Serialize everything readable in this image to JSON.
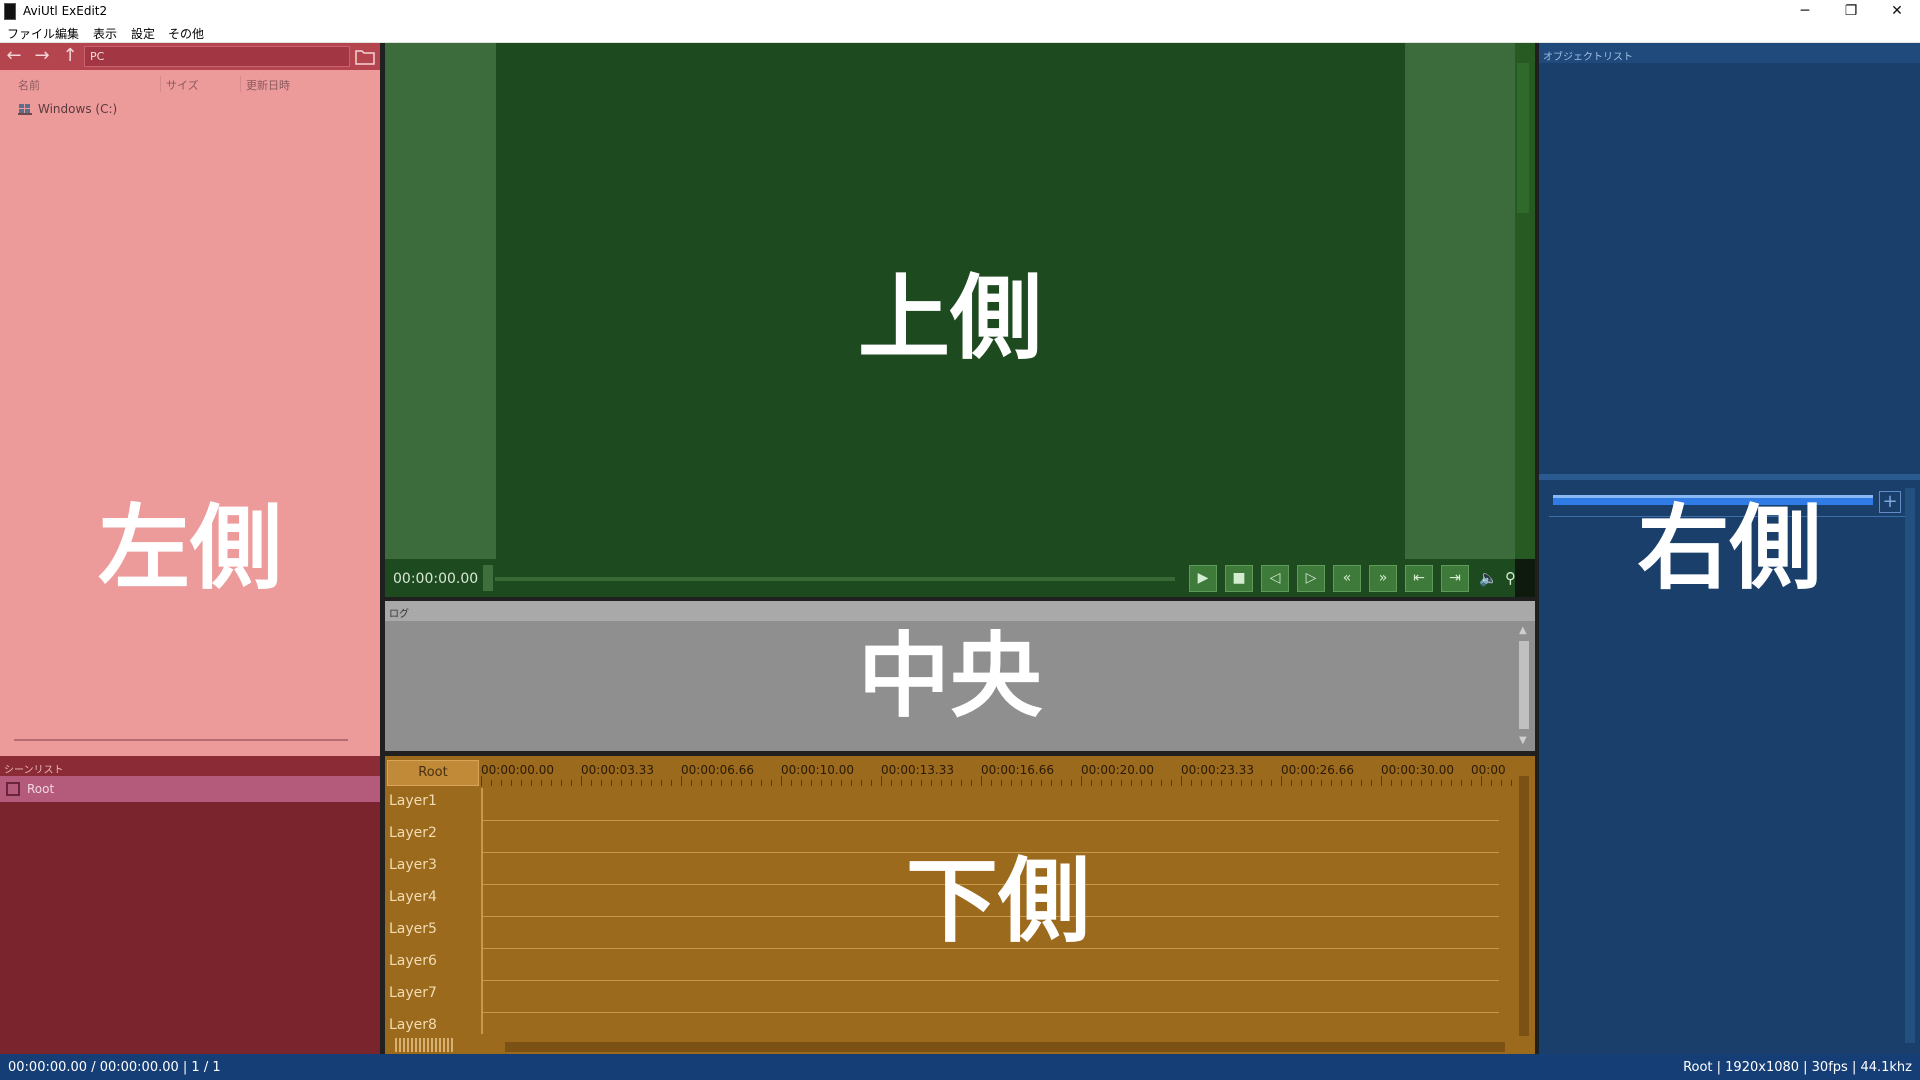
{
  "window": {
    "title": "AviUtl ExEdit2",
    "controls": {
      "minimize": "─",
      "maximize": "❐",
      "close": "✕"
    }
  },
  "menu": {
    "items": [
      "ファイル",
      "編集",
      "表示",
      "設定",
      "その他"
    ]
  },
  "explorer": {
    "path": "PC",
    "nav": {
      "back": "←",
      "forward": "→",
      "up": "↑"
    },
    "columns": [
      "名前",
      "サイズ",
      "更新日時"
    ],
    "items": [
      {
        "label": "Windows (C:)"
      }
    ],
    "overlay_label": "左側"
  },
  "scene_list": {
    "header": "シーンリスト",
    "items": [
      {
        "label": "Root"
      }
    ]
  },
  "preview": {
    "time": "00:00:00.00",
    "overlay_label": "上側",
    "buttons": [
      {
        "name": "play-button",
        "glyph": "▶"
      },
      {
        "name": "stop-button",
        "glyph": "■"
      },
      {
        "name": "prev-frame-button",
        "glyph": "◁"
      },
      {
        "name": "next-frame-button",
        "glyph": "▷"
      },
      {
        "name": "rewind-button",
        "glyph": "«"
      },
      {
        "name": "fast-forward-button",
        "glyph": "»"
      },
      {
        "name": "go-start-button",
        "glyph": "⇤"
      },
      {
        "name": "go-end-button",
        "glyph": "⇥"
      }
    ],
    "volume_icon": "🔈",
    "zoom_icon": "⚲"
  },
  "log": {
    "header": "ログ",
    "overlay_label": "中央"
  },
  "timeline": {
    "root_tab": "Root",
    "ruler_labels": [
      "00:00:00.00",
      "00:00:03.33",
      "00:00:06.66",
      "00:00:10.00",
      "00:00:13.33",
      "00:00:16.66",
      "00:00:20.00",
      "00:00:23.33",
      "00:00:26.66",
      "00:00:30.00",
      "00:00"
    ],
    "layers": [
      "Layer1",
      "Layer2",
      "Layer3",
      "Layer4",
      "Layer5",
      "Layer6",
      "Layer7",
      "Layer8"
    ],
    "overlay_label": "下側"
  },
  "object_list": {
    "header": "オブジェクトリスト",
    "add_button": "+",
    "overlay_label": "右側"
  },
  "status": {
    "left": "00:00:00.00 / 00:00:00.00  |  1 / 1",
    "right": "Root  |  1920x1080  |  30fps  |  44.1khz"
  },
  "colors": {
    "explorer": "#ec9a9a",
    "scene_list": "#7a242e",
    "preview": "#1e4a20",
    "log": "#8f8f8f",
    "timeline": "#9c6a1c",
    "object_list": "#1a3f6b",
    "statusbar": "#163e76"
  }
}
